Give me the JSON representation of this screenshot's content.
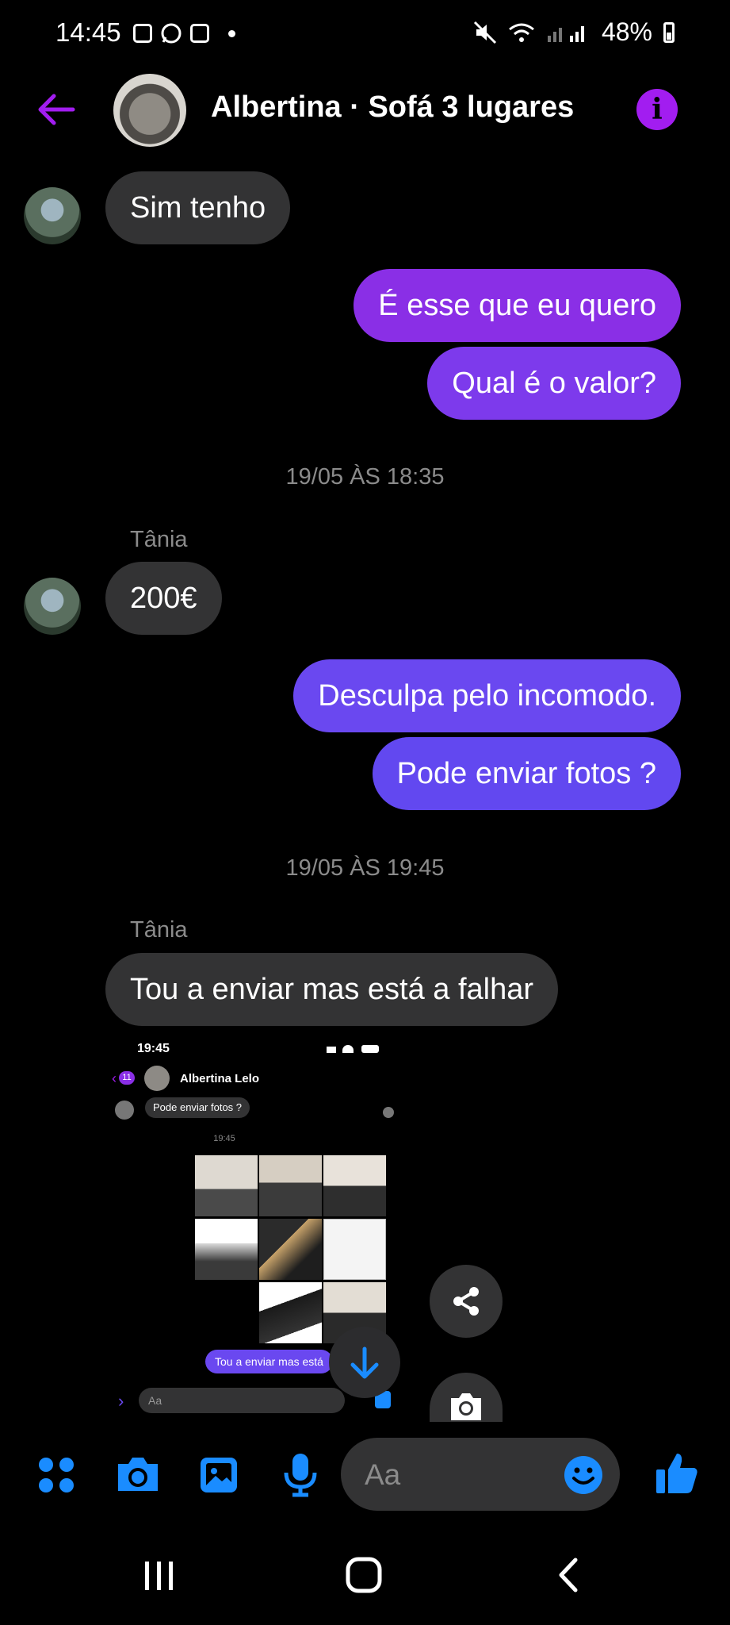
{
  "status_bar": {
    "time": "14:45",
    "battery": "48%"
  },
  "header": {
    "title": "Albertina · Sofá 3 lugares",
    "info_glyph": "i"
  },
  "messages": [
    {
      "text": "Sim tenho"
    },
    {
      "text": "É esse que eu quero"
    },
    {
      "text": "Qual é o valor?"
    },
    {
      "timestamp": "19/05 ÀS 18:35"
    },
    {
      "sender": "Tânia"
    },
    {
      "text": "200€"
    },
    {
      "text": "Desculpa pelo incomodo."
    },
    {
      "text": "Pode enviar fotos ?"
    },
    {
      "timestamp": "19/05 ÀS 19:45"
    },
    {
      "sender": "Tânia"
    },
    {
      "text": "Tou a enviar mas está a falhar"
    }
  ],
  "attachment": {
    "time": "19:45",
    "badge": "11",
    "contact": "Albertina Lelo",
    "prev_message": "Pode enviar fotos ?",
    "timestamp": "19:45",
    "sent_message": "Tou a enviar mas está",
    "input_placeholder": "Aa"
  },
  "composer": {
    "placeholder": "Aa"
  },
  "colors": {
    "accent_purple": "#a21df0",
    "bubble_purple": "#8a2fe6",
    "bubble_violet": "#6a48f0",
    "icon_blue": "#1a8cff",
    "incoming_bubble": "#333334"
  },
  "icons": [
    "back-arrow-icon",
    "info-icon",
    "share-icon",
    "camera-icon",
    "scroll-down-icon",
    "apps-icon",
    "gallery-icon",
    "microphone-icon",
    "emoji-icon",
    "thumbs-up-icon"
  ]
}
